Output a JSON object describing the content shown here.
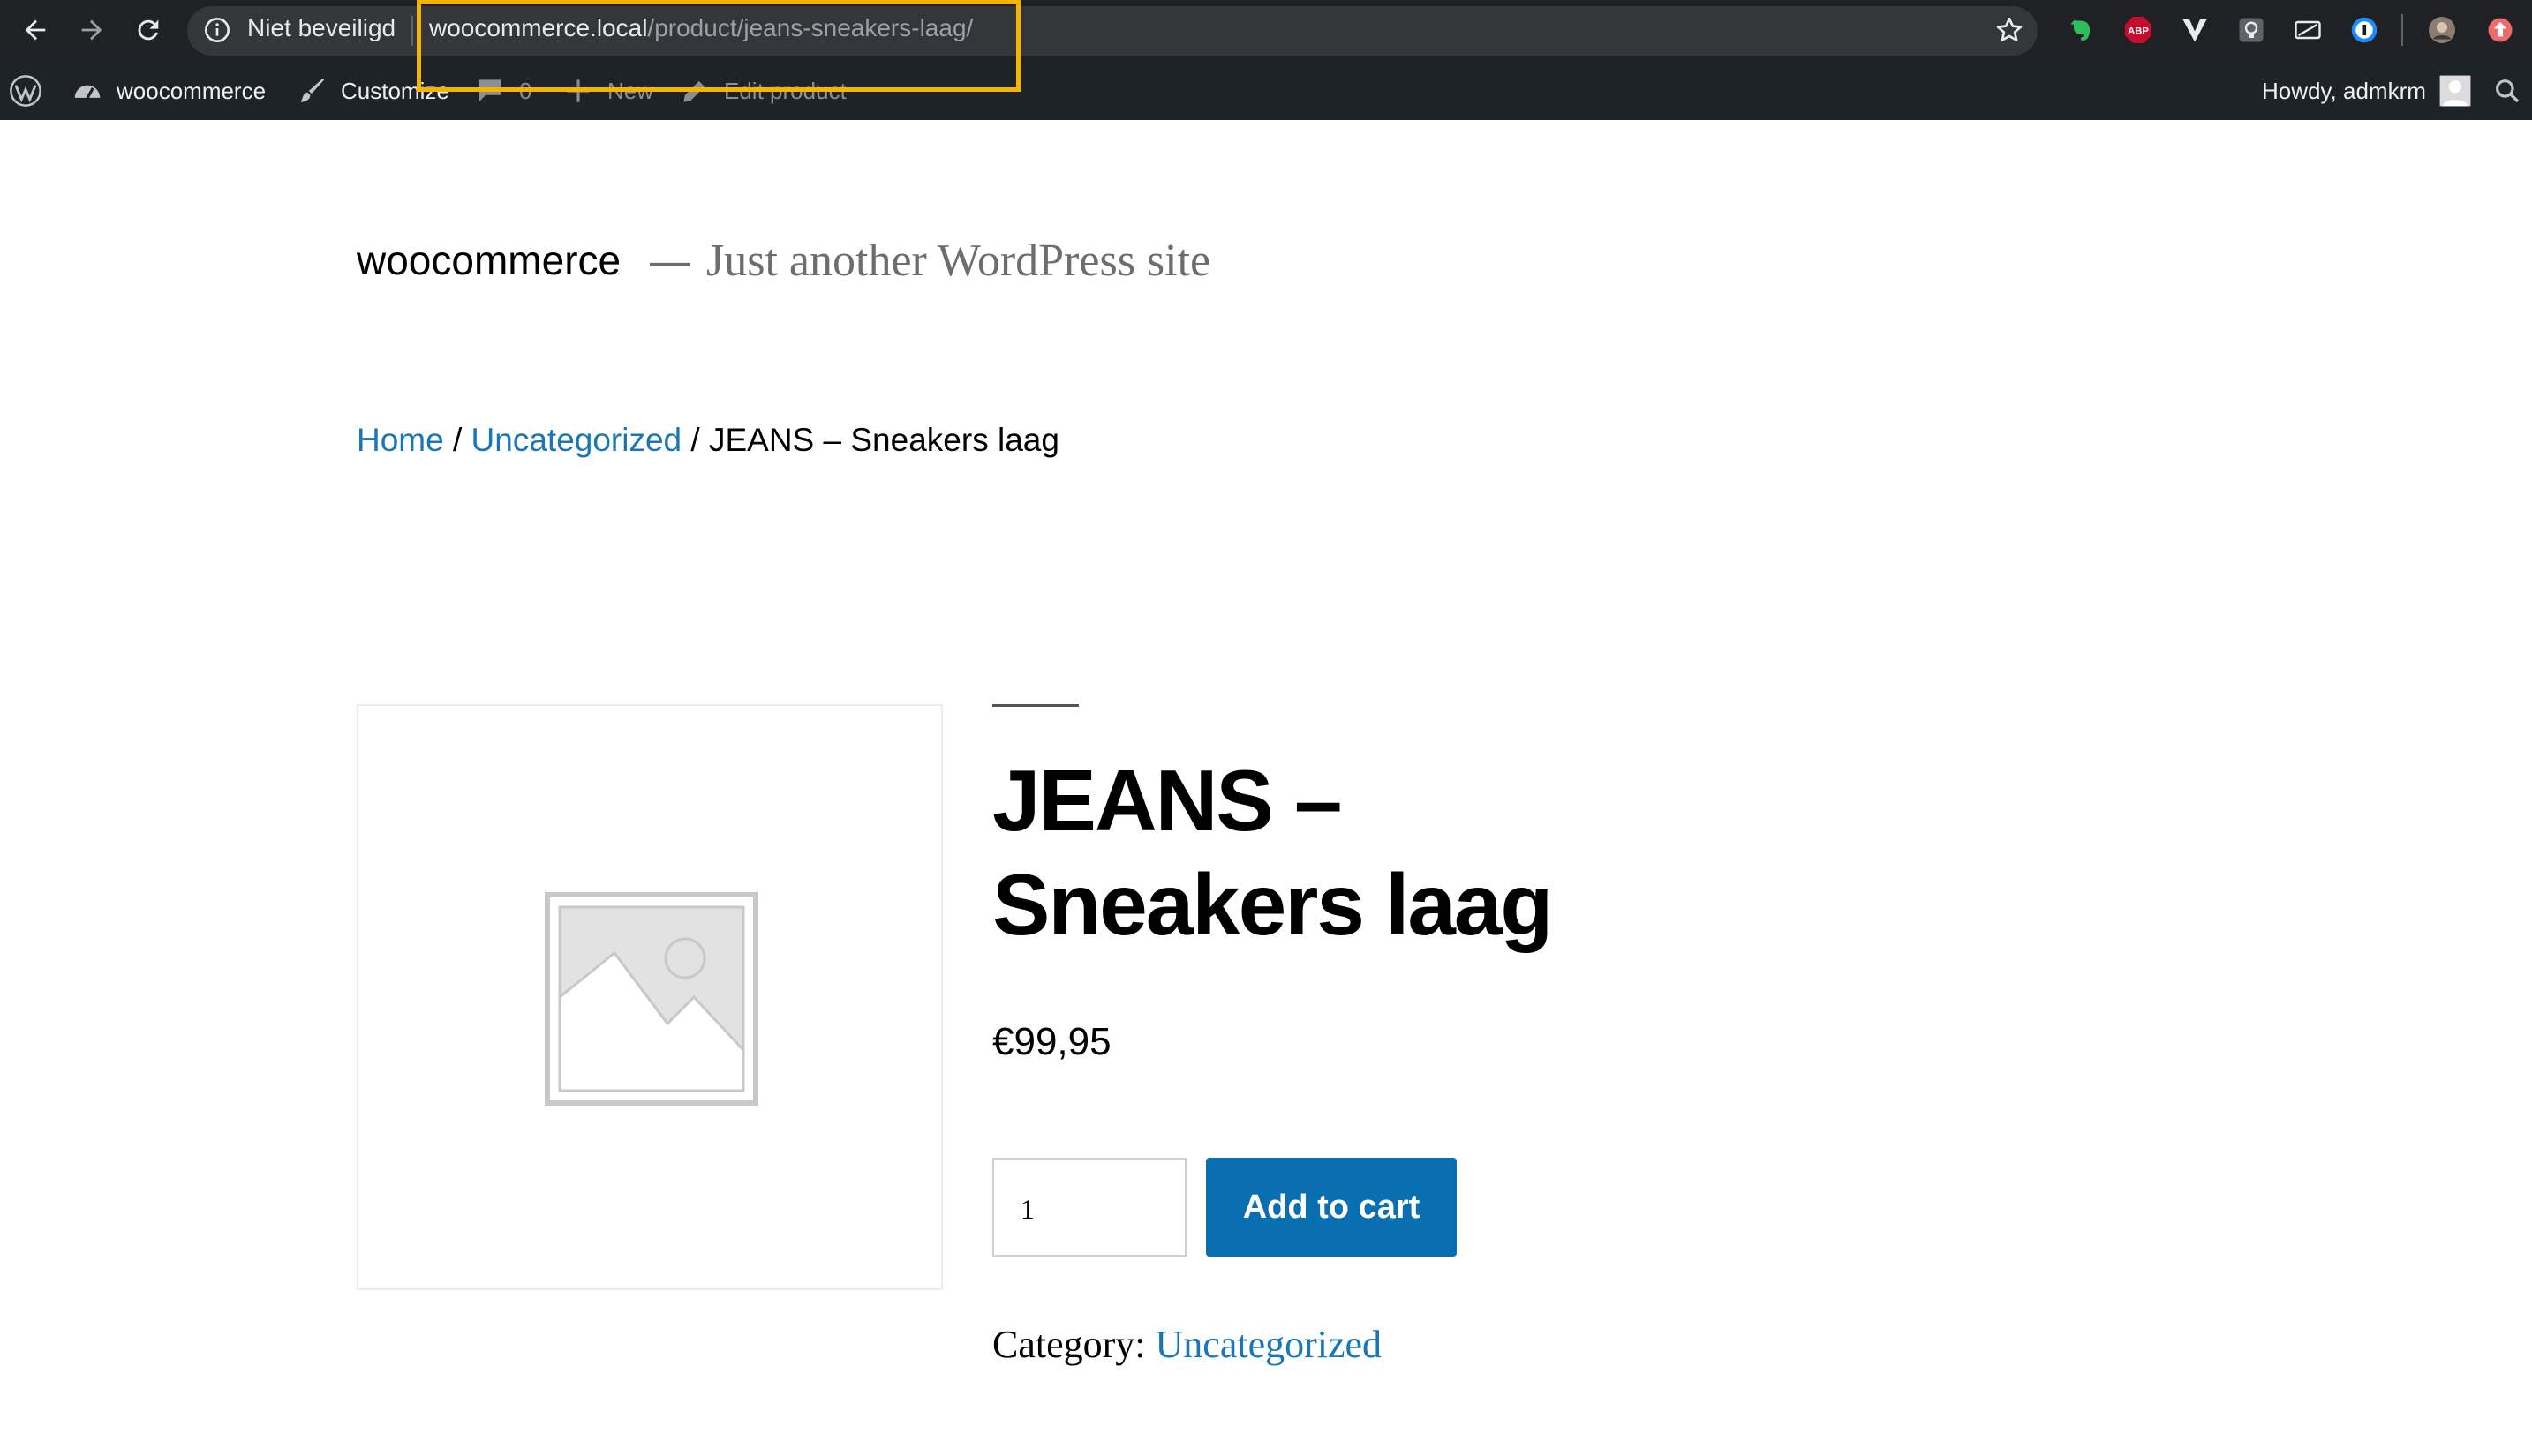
{
  "browser": {
    "security_label": "Niet beveiligd",
    "url_host": "woocommerce.local",
    "url_path": "/product/jeans-sneakers-laag/",
    "highlight_color": "#f4b400",
    "extensions": [
      "evernote-icon",
      "adblock-plus-icon",
      "vivaldi-icon",
      "lightbulb-icon",
      "screen-icon",
      "onepassword-icon",
      "profile-avatar",
      "update-icon"
    ],
    "extension_text": {
      "abp": "ABP"
    }
  },
  "adminbar": {
    "site_name": "woocommerce",
    "customize": "Customize",
    "comments_count": "0",
    "new": "New",
    "edit": "Edit product",
    "greeting": "Howdy, admkrm"
  },
  "site": {
    "title": "woocommerce",
    "dash": "—",
    "tagline": "Just another WordPress site"
  },
  "breadcrumb": {
    "home": "Home",
    "sep": " / ",
    "category": "Uncategorized",
    "current": "JEANS – Sneakers laag"
  },
  "product": {
    "title": "JEANS – Sneakers laag",
    "price": "€99,95",
    "quantity": "1",
    "add_to_cart": "Add to cart",
    "category_label": "Category:",
    "category": "Uncategorized"
  },
  "colors": {
    "link": "#1a76b6",
    "button": "#0a6fb0",
    "adminbar": "#1d2327",
    "chrome": "#202124"
  }
}
